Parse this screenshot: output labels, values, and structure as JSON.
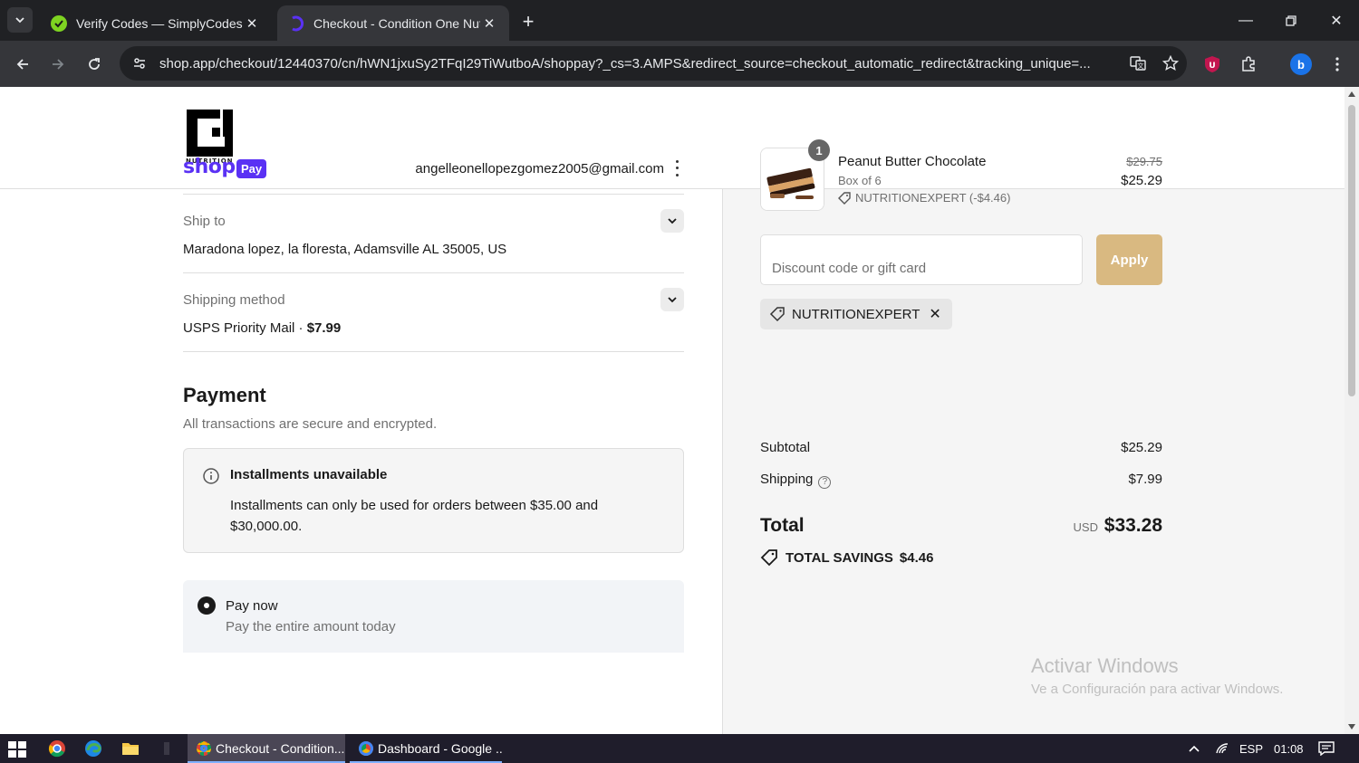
{
  "browser": {
    "tabs": [
      {
        "title": "Verify Codes — SimplyCodes",
        "active": false
      },
      {
        "title": "Checkout - Condition One Nutr",
        "active": true
      }
    ],
    "url": "shop.app/checkout/12440370/cn/hWN1jxuSy2TFqI29TiWutboA/shoppay?_cs=3.AMPS&redirect_source=checkout_automatic_redirect&tracking_unique=...",
    "profile_initial": "b"
  },
  "header": {
    "logo_text": "NUTRITION"
  },
  "shoppay": {
    "shop_text": "shop",
    "pay_badge": "Pay",
    "email": "angelleonellopezgomez2005@gmail.com"
  },
  "ship_to": {
    "label": "Ship to",
    "value": "Maradona lopez, la floresta, Adamsville AL 35005, US"
  },
  "shipping_method": {
    "label": "Shipping method",
    "value": "USPS Priority Mail · ",
    "price": "$7.99"
  },
  "payment": {
    "title": "Payment",
    "subtitle": "All transactions are secure and encrypted.",
    "installments_title": "Installments unavailable",
    "installments_text": "Installments can only be used for orders between $35.00 and $30,000.00.",
    "pay_now_title": "Pay now",
    "pay_now_sub": "Pay the entire amount today"
  },
  "order": {
    "product": {
      "quantity": "1",
      "name": "Peanut Butter Chocolate",
      "variant": "Box of 6",
      "discount": "NUTRITIONEXPERT (-$4.46)",
      "original_price": "$29.75",
      "price": "$25.29"
    },
    "discount_placeholder": "Discount code or gift card",
    "discount_value": "",
    "apply_label": "Apply",
    "applied_code": "NUTRITIONEXPERT",
    "subtotal_label": "Subtotal",
    "subtotal_value": "$25.29",
    "shipping_label": "Shipping",
    "shipping_value": "$7.99",
    "total_label": "Total",
    "currency": "USD",
    "total_value": "$33.28",
    "savings_label": "TOTAL SAVINGS",
    "savings_value": "$4.46"
  },
  "watermark": {
    "line1": "Activar Windows",
    "line2": "Ve a Configuración para activar Windows."
  },
  "taskbar": {
    "tasks": [
      "Checkout - Condition...",
      "Dashboard - Google ..."
    ],
    "language": "ESP",
    "time": "01:08"
  },
  "colors": {
    "shop_purple": "#5a31f4",
    "apply_button": "#d9b981",
    "browser_dark": "#202124"
  }
}
